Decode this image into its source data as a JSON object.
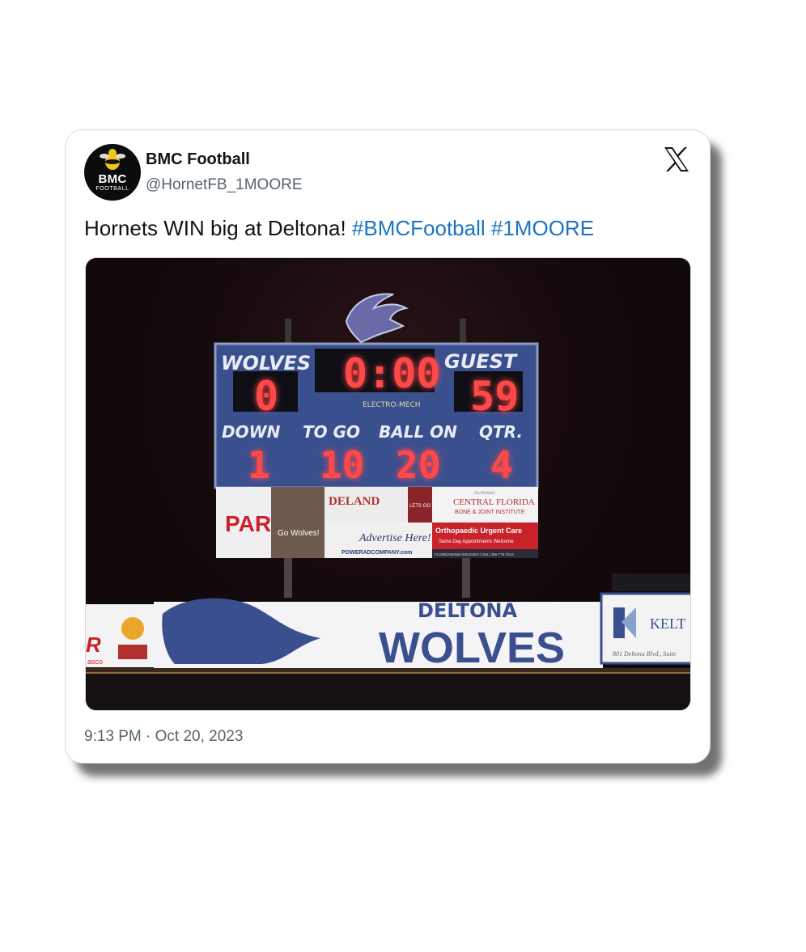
{
  "tweet": {
    "author_name": "BMC Football",
    "author_handle": "@HornetFB_1MOORE",
    "avatar_line1": "BMC",
    "avatar_line2": "FOOTBALL",
    "text": "Hornets WIN big at Deltona! ",
    "hashtags": [
      "#BMCFootball",
      "#1MOORE"
    ],
    "timestamp": "9:13 PM · Oct 20, 2023"
  },
  "scoreboard": {
    "home_label": "WOLVES",
    "home_score": "0",
    "clock": "0:00",
    "guest_label": "GUEST",
    "guest_score": "59",
    "brand": "ELECTRO-MECH",
    "down_label": "DOWN",
    "down": "1",
    "togo_label": "TO GO",
    "togo": "10",
    "ballon_label": "BALL ON",
    "ballon": "20",
    "qtr_label": "QTR.",
    "qtr": "4",
    "sponsors": {
      "par": "PAR",
      "go_wolves": "Go Wolves!",
      "deland": "DELAND",
      "lets_go": "LETS GO WOLVES",
      "advertise": "Advertise Here!",
      "advertise_sub": "POWERADCOMPANY.com",
      "cfl_small": "Go Wolves!",
      "cfl1": "CENTRAL FLORIDA",
      "cfl2": "BONE & JOINT INSTITUTE",
      "ortho": "Orthopaedic Urgent Care",
      "ortho_sub": "Same Day Appointments Welcome",
      "cfl_footer": "FLORIDABONEANDJOINT.COM | 386-775-2012"
    }
  },
  "banner": {
    "deltona": "DELTONA",
    "wolves": "WOLVES",
    "left_letters": "R",
    "left_sub": "asco",
    "kelton": "KELT",
    "kelton_sub": "801 Deltona Blvd., Suite"
  },
  "colors": {
    "accent": "#1d74c4",
    "board_blue": "#3a4f8e",
    "led_red": "#ff4a4a"
  },
  "icons": [
    "x-logo-icon",
    "bee-mascot-icon",
    "wolf-head-icon"
  ]
}
